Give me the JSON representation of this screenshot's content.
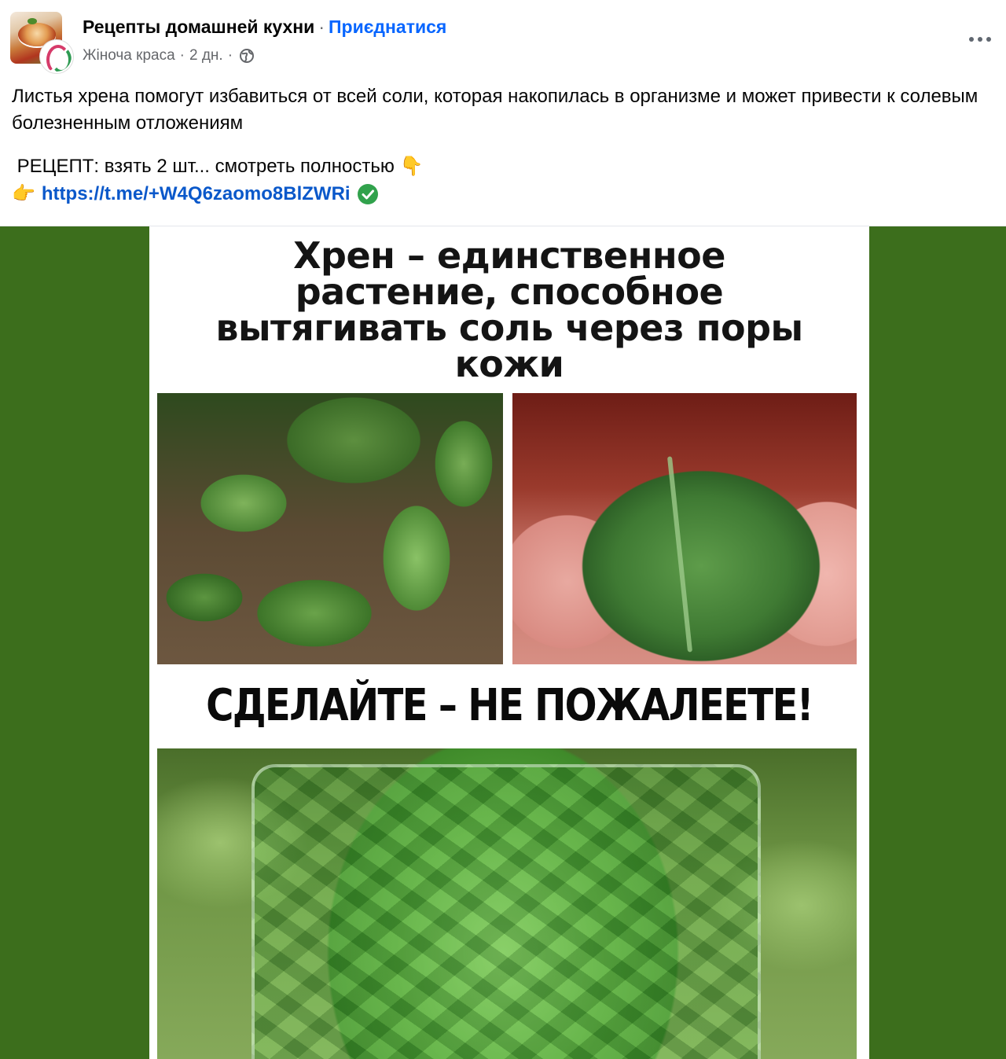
{
  "post": {
    "page_name": "Рецепты домашней кухни",
    "separator": "·",
    "join_label": "Приєднатися",
    "author": "Жіноча краса",
    "time": "2 дн.",
    "audience_icon": "globe-icon",
    "more_icon": "more-options-icon",
    "text": "Листья хрена помогут избавиться от всей соли, которая накопилась в организме и может привести к солевым болезненным отложениям",
    "recipe_text": " РЕЦЕПТ: взять 2 шт... смотреть полностью ",
    "recipe_emoji": "👇",
    "link_emoji": "👉",
    "link": "https://t.me/+W4Q6zaomo8BlZWRi",
    "link_badge_icon": "check-circle-icon"
  },
  "media": {
    "headline_lines": [
      "Хрен – единственное",
      "растение, способное",
      "вытягивать соль через поры",
      "кожи"
    ],
    "slogan": "СДЕЛАЙТЕ – НЕ ПОЖАЛЕЕТЕ!",
    "background_color": "#3c6e1c"
  },
  "colors": {
    "link_blue": "#0866ff",
    "url_blue": "#0a58ca",
    "meta_gray": "#65676b",
    "check_green": "#31a24c"
  }
}
